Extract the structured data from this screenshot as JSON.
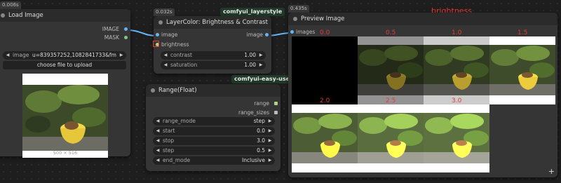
{
  "load_image": {
    "timing": "0.006s",
    "title": "Load Image",
    "out_image": "IMAGE",
    "out_mask": "MASK",
    "image_widget_label": "image",
    "image_widget_value": "u=839357252,1082841733&fm=2...",
    "upload_button": "choose file to upload",
    "dimensions": "500 × 516"
  },
  "layercolor": {
    "timing": "0.032s",
    "tag": "comfyui_layerstyle",
    "title": "LayerColor: Brightness & Contrast",
    "in_image": "image",
    "in_brightness": "brightness",
    "out_image": "image",
    "contrast_label": "contrast",
    "contrast_value": "1.00",
    "saturation_label": "saturation",
    "saturation_value": "1.00",
    "tag2": "comfyui-easy-use"
  },
  "range_float": {
    "title": "Range(Float)",
    "out_range": "range",
    "out_range_sizes": "range_sizes",
    "range_mode_label": "range_mode",
    "range_mode_value": "step",
    "start_label": "start",
    "start_value": "0.0",
    "stop_label": "stop",
    "stop_value": "3.0",
    "step_label": "step",
    "step_value": "0.5",
    "end_mode_label": "end_mode",
    "end_mode_value": "Inclusive"
  },
  "preview": {
    "timing": "0.435s",
    "title": "Preview Image",
    "in_images": "images",
    "annotation": "brightness",
    "labels": [
      "0.0",
      "0.5",
      "1.0",
      "1.5",
      "2.0",
      "2.5",
      "3.0"
    ],
    "brightness_levels": [
      0.0,
      0.5,
      1.0,
      1.5,
      2.0,
      2.5,
      3.0
    ]
  },
  "canvas": {
    "plus_label": "+"
  },
  "colors": {
    "image_slot": "#64b5f6",
    "mask_slot": "#81c784",
    "float_slot": "#aed581",
    "annotation": "#e53935",
    "tag_bg": "#1f3a28"
  }
}
